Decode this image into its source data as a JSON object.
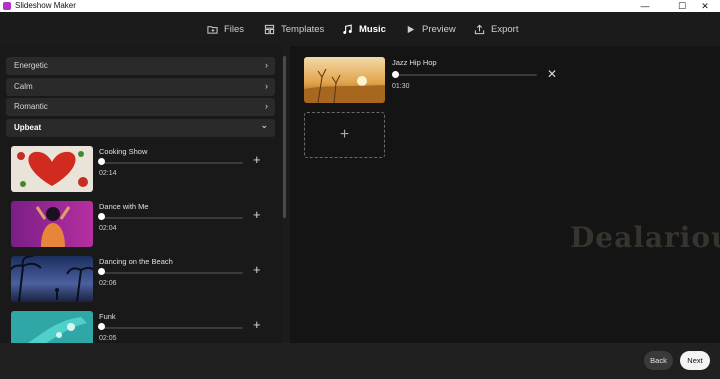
{
  "window": {
    "title": "Slideshow Maker",
    "minimize": "—",
    "maximize": "☐",
    "close": "✕"
  },
  "nav": {
    "tabs": [
      {
        "label": "Files",
        "icon": "folder-icon"
      },
      {
        "label": "Templates",
        "icon": "templates-icon"
      },
      {
        "label": "Music",
        "icon": "music-note-icon",
        "active": true
      },
      {
        "label": "Preview",
        "icon": "play-icon"
      },
      {
        "label": "Export",
        "icon": "export-icon"
      }
    ]
  },
  "categories": [
    {
      "label": "Energetic",
      "chevron": "›"
    },
    {
      "label": "Calm",
      "chevron": "›"
    },
    {
      "label": "Romantic",
      "chevron": "›"
    },
    {
      "label": "Upbeat",
      "chevron": "⌄",
      "open": true
    }
  ],
  "tracks": [
    {
      "name": "Cooking Show",
      "duration": "02:14",
      "add": "+"
    },
    {
      "name": "Dance with Me",
      "duration": "02:04",
      "add": "+"
    },
    {
      "name": "Dancing on the Beach",
      "duration": "02:06",
      "add": "+"
    },
    {
      "name": "Funk",
      "duration": "02:05",
      "add": "+"
    }
  ],
  "selected": {
    "name": "Jazz Hip Hop",
    "duration": "01:30",
    "progress": 0,
    "remove": "✕",
    "add_slot": "+"
  },
  "watermark": "Dealarious",
  "footer": {
    "back_label": "Back",
    "next_label": "Next"
  },
  "colors": {
    "accent_app_icon": "#b330c9",
    "background": "#1c1c1c"
  }
}
